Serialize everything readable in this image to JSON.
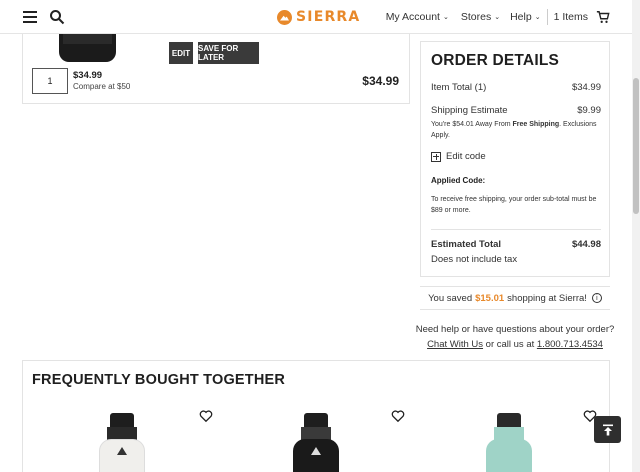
{
  "header": {
    "logo_text": "SIERRA",
    "nav": {
      "account": "My Account",
      "stores": "Stores",
      "help": "Help",
      "cart": "1 Items"
    }
  },
  "cart_item": {
    "edit_label": "EDIT",
    "save_label": "SAVE FOR LATER",
    "quantity": "1",
    "price": "$34.99",
    "compare": "Compare at $50",
    "line_total": "$34.99"
  },
  "order": {
    "title": "ORDER DETAILS",
    "item_total_label": "Item Total (1)",
    "item_total_value": "$34.99",
    "shipping_label": "Shipping Estimate",
    "shipping_value": "$9.99",
    "free_ship_pre": "You're $54.01 Away From ",
    "free_ship_bold": "Free Shipping",
    "free_ship_post": ". Exclusions Apply.",
    "edit_code": "Edit code",
    "applied_code": "Applied Code:",
    "free_ship_note": "To receive free shipping, your order sub-total must be $89 or more.",
    "est_total_label": "Estimated Total",
    "est_total_value": "$44.98",
    "tax_note": "Does not include tax"
  },
  "savings": {
    "pre": "You saved",
    "amount": "$15.01",
    "post": "shopping at Sierra!"
  },
  "help": {
    "question": "Need help or have questions about your order?",
    "chat": "Chat With Us",
    "middle": "or call us at",
    "phone": "1.800.713.4534"
  },
  "fbt": {
    "title": "FREQUENTLY BOUGHT TOGETHER",
    "products": [
      {
        "color": "#f0efec",
        "cap": "#1e1e1e"
      },
      {
        "color": "#1a1a1a",
        "cap": "#1e1e1e"
      },
      {
        "color": "#9fd3c7",
        "cap": "#2a2a2a"
      }
    ]
  }
}
